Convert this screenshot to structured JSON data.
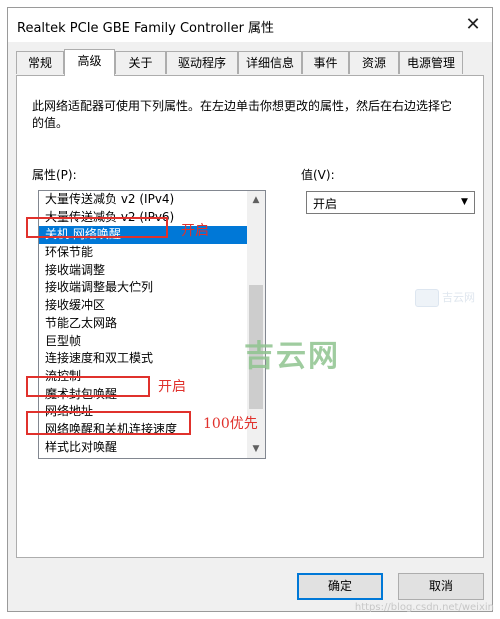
{
  "window": {
    "title": "Realtek PCIe GBE Family Controller 属性",
    "close_symbol": "✕"
  },
  "tabs": [
    {
      "label": "常规"
    },
    {
      "label": "高级"
    },
    {
      "label": "关于"
    },
    {
      "label": "驱动程序"
    },
    {
      "label": "详细信息"
    },
    {
      "label": "事件"
    },
    {
      "label": "资源"
    },
    {
      "label": "电源管理"
    }
  ],
  "panel": {
    "description": "此网络适配器可使用下列属性。在左边单击你想更改的属性，然后在右边选择它的值。",
    "property_label": "属性(P):",
    "value_label": "值(V):",
    "properties": [
      {
        "label": "大量传送减负 v2 (IPv4)"
      },
      {
        "label": "大量传送减负 v2 (IPv6)"
      },
      {
        "label": "关机 网络唤醒"
      },
      {
        "label": "环保节能"
      },
      {
        "label": "接收端调整"
      },
      {
        "label": "接收端调整最大伫列"
      },
      {
        "label": "接收缓冲区"
      },
      {
        "label": "节能乙太网路"
      },
      {
        "label": "巨型帧"
      },
      {
        "label": "连接速度和双工模式"
      },
      {
        "label": "流控制"
      },
      {
        "label": "魔术封包唤醒"
      },
      {
        "label": "网络地址"
      },
      {
        "label": "网络唤醒和关机连接速度"
      },
      {
        "label": "样式比对唤醒"
      }
    ],
    "selected_index": 2,
    "selected_value": "开启",
    "scroll_up_symbol": "▲",
    "scroll_down_symbol": "▼",
    "dropdown_symbol": "▼"
  },
  "annotations": {
    "note_1": "开启",
    "note_2": "开启",
    "note_3": "100优先"
  },
  "watermark": {
    "logo_text": "吉云网",
    "faint_text": "吉云网",
    "url_text": "https://blog.csdn.net/weixin"
  },
  "buttons": {
    "ok_label": "确定",
    "cancel_label": "取消"
  },
  "colors": {
    "selection": "#0078d7",
    "annotation": "#e0312c",
    "watermark": "#8fc48f"
  }
}
